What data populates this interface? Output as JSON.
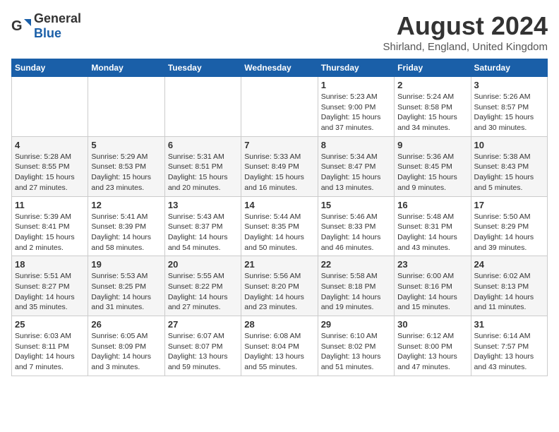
{
  "logo": {
    "general": "General",
    "blue": "Blue"
  },
  "header": {
    "month_year": "August 2024",
    "location": "Shirland, England, United Kingdom"
  },
  "weekdays": [
    "Sunday",
    "Monday",
    "Tuesday",
    "Wednesday",
    "Thursday",
    "Friday",
    "Saturday"
  ],
  "weeks": [
    [
      {
        "day": "",
        "info": ""
      },
      {
        "day": "",
        "info": ""
      },
      {
        "day": "",
        "info": ""
      },
      {
        "day": "",
        "info": ""
      },
      {
        "day": "1",
        "info": "Sunrise: 5:23 AM\nSunset: 9:00 PM\nDaylight: 15 hours\nand 37 minutes."
      },
      {
        "day": "2",
        "info": "Sunrise: 5:24 AM\nSunset: 8:58 PM\nDaylight: 15 hours\nand 34 minutes."
      },
      {
        "day": "3",
        "info": "Sunrise: 5:26 AM\nSunset: 8:57 PM\nDaylight: 15 hours\nand 30 minutes."
      }
    ],
    [
      {
        "day": "4",
        "info": "Sunrise: 5:28 AM\nSunset: 8:55 PM\nDaylight: 15 hours\nand 27 minutes."
      },
      {
        "day": "5",
        "info": "Sunrise: 5:29 AM\nSunset: 8:53 PM\nDaylight: 15 hours\nand 23 minutes."
      },
      {
        "day": "6",
        "info": "Sunrise: 5:31 AM\nSunset: 8:51 PM\nDaylight: 15 hours\nand 20 minutes."
      },
      {
        "day": "7",
        "info": "Sunrise: 5:33 AM\nSunset: 8:49 PM\nDaylight: 15 hours\nand 16 minutes."
      },
      {
        "day": "8",
        "info": "Sunrise: 5:34 AM\nSunset: 8:47 PM\nDaylight: 15 hours\nand 13 minutes."
      },
      {
        "day": "9",
        "info": "Sunrise: 5:36 AM\nSunset: 8:45 PM\nDaylight: 15 hours\nand 9 minutes."
      },
      {
        "day": "10",
        "info": "Sunrise: 5:38 AM\nSunset: 8:43 PM\nDaylight: 15 hours\nand 5 minutes."
      }
    ],
    [
      {
        "day": "11",
        "info": "Sunrise: 5:39 AM\nSunset: 8:41 PM\nDaylight: 15 hours\nand 2 minutes."
      },
      {
        "day": "12",
        "info": "Sunrise: 5:41 AM\nSunset: 8:39 PM\nDaylight: 14 hours\nand 58 minutes."
      },
      {
        "day": "13",
        "info": "Sunrise: 5:43 AM\nSunset: 8:37 PM\nDaylight: 14 hours\nand 54 minutes."
      },
      {
        "day": "14",
        "info": "Sunrise: 5:44 AM\nSunset: 8:35 PM\nDaylight: 14 hours\nand 50 minutes."
      },
      {
        "day": "15",
        "info": "Sunrise: 5:46 AM\nSunset: 8:33 PM\nDaylight: 14 hours\nand 46 minutes."
      },
      {
        "day": "16",
        "info": "Sunrise: 5:48 AM\nSunset: 8:31 PM\nDaylight: 14 hours\nand 43 minutes."
      },
      {
        "day": "17",
        "info": "Sunrise: 5:50 AM\nSunset: 8:29 PM\nDaylight: 14 hours\nand 39 minutes."
      }
    ],
    [
      {
        "day": "18",
        "info": "Sunrise: 5:51 AM\nSunset: 8:27 PM\nDaylight: 14 hours\nand 35 minutes."
      },
      {
        "day": "19",
        "info": "Sunrise: 5:53 AM\nSunset: 8:25 PM\nDaylight: 14 hours\nand 31 minutes."
      },
      {
        "day": "20",
        "info": "Sunrise: 5:55 AM\nSunset: 8:22 PM\nDaylight: 14 hours\nand 27 minutes."
      },
      {
        "day": "21",
        "info": "Sunrise: 5:56 AM\nSunset: 8:20 PM\nDaylight: 14 hours\nand 23 minutes."
      },
      {
        "day": "22",
        "info": "Sunrise: 5:58 AM\nSunset: 8:18 PM\nDaylight: 14 hours\nand 19 minutes."
      },
      {
        "day": "23",
        "info": "Sunrise: 6:00 AM\nSunset: 8:16 PM\nDaylight: 14 hours\nand 15 minutes."
      },
      {
        "day": "24",
        "info": "Sunrise: 6:02 AM\nSunset: 8:13 PM\nDaylight: 14 hours\nand 11 minutes."
      }
    ],
    [
      {
        "day": "25",
        "info": "Sunrise: 6:03 AM\nSunset: 8:11 PM\nDaylight: 14 hours\nand 7 minutes."
      },
      {
        "day": "26",
        "info": "Sunrise: 6:05 AM\nSunset: 8:09 PM\nDaylight: 14 hours\nand 3 minutes."
      },
      {
        "day": "27",
        "info": "Sunrise: 6:07 AM\nSunset: 8:07 PM\nDaylight: 13 hours\nand 59 minutes."
      },
      {
        "day": "28",
        "info": "Sunrise: 6:08 AM\nSunset: 8:04 PM\nDaylight: 13 hours\nand 55 minutes."
      },
      {
        "day": "29",
        "info": "Sunrise: 6:10 AM\nSunset: 8:02 PM\nDaylight: 13 hours\nand 51 minutes."
      },
      {
        "day": "30",
        "info": "Sunrise: 6:12 AM\nSunset: 8:00 PM\nDaylight: 13 hours\nand 47 minutes."
      },
      {
        "day": "31",
        "info": "Sunrise: 6:14 AM\nSunset: 7:57 PM\nDaylight: 13 hours\nand 43 minutes."
      }
    ]
  ]
}
